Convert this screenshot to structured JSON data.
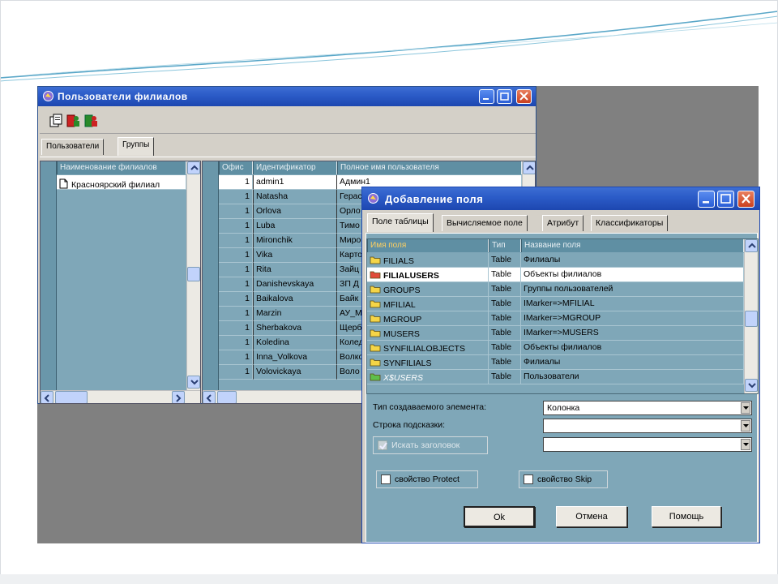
{
  "window_branches": {
    "title": "Пользователи филиалов",
    "tabs": [
      {
        "label": "Пользователи",
        "active": false
      },
      {
        "label": "Группы",
        "active": true
      }
    ],
    "branches_grid": {
      "header": "Наименование филиалов",
      "rows": [
        "Красноярский филиал"
      ]
    },
    "users_grid": {
      "headers": [
        "Офис",
        "Идентификатор",
        "Полное имя пользователя"
      ],
      "rows": [
        {
          "office": "1",
          "id": "admin1",
          "name": "Админ1"
        },
        {
          "office": "1",
          "id": "Natasha",
          "name": "Герас"
        },
        {
          "office": "1",
          "id": "Orlova",
          "name": "Орло"
        },
        {
          "office": "1",
          "id": "Luba",
          "name": "Тимо"
        },
        {
          "office": "1",
          "id": "Mironchik",
          "name": "Миро"
        },
        {
          "office": "1",
          "id": "Vika",
          "name": "Карто"
        },
        {
          "office": "1",
          "id": "Rita",
          "name": "Зайц"
        },
        {
          "office": "1",
          "id": "Danishevskaya",
          "name": "ЗП Д"
        },
        {
          "office": "1",
          "id": "Baikalova",
          "name": "Байк"
        },
        {
          "office": "1",
          "id": "Marzin",
          "name": "АУ_М"
        },
        {
          "office": "1",
          "id": "Sherbakova",
          "name": "Щерб"
        },
        {
          "office": "1",
          "id": "Koledina",
          "name": "Колед"
        },
        {
          "office": "1",
          "id": "Inna_Volkova",
          "name": "Волко"
        },
        {
          "office": "1",
          "id": "Volovickaya",
          "name": "Воло"
        }
      ]
    }
  },
  "dialog_add_field": {
    "title": "Добавление поля",
    "tabs": [
      {
        "label": "Поле таблицы",
        "active": true
      },
      {
        "label": "Вычисляемое поле",
        "active": false
      },
      {
        "label": "Атрибут",
        "active": false
      },
      {
        "label": "Классификаторы",
        "active": false
      }
    ],
    "fields_grid": {
      "headers": [
        "Имя поля",
        "Тип",
        "Название поля"
      ],
      "rows": [
        {
          "name": "FILIALS",
          "type": "Table",
          "title": "Филиалы",
          "selected": false,
          "italic": false,
          "icon": "folder-icon"
        },
        {
          "name": "FILIALUSERS",
          "type": "Table",
          "title": "Объекты филиалов",
          "selected": true,
          "italic": false,
          "icon": "folder-red-icon"
        },
        {
          "name": "GROUPS",
          "type": "Table",
          "title": "Группы пользователей",
          "selected": false,
          "italic": false,
          "icon": "folder-icon"
        },
        {
          "name": "MFILIAL",
          "type": "Table",
          "title": "IMarker=>MFILIAL",
          "selected": false,
          "italic": false,
          "icon": "folder-icon"
        },
        {
          "name": "MGROUP",
          "type": "Table",
          "title": "IMarker=>MGROUP",
          "selected": false,
          "italic": false,
          "icon": "folder-icon"
        },
        {
          "name": "MUSERS",
          "type": "Table",
          "title": "IMarker=>MUSERS",
          "selected": false,
          "italic": false,
          "icon": "folder-icon"
        },
        {
          "name": "SYNFILIALOBJECTS",
          "type": "Table",
          "title": "Объекты филиалов",
          "selected": false,
          "italic": false,
          "icon": "folder-icon"
        },
        {
          "name": "SYNFILIALS",
          "type": "Table",
          "title": "Филиалы",
          "selected": false,
          "italic": false,
          "icon": "folder-icon"
        },
        {
          "name": "X$USERS",
          "type": "Table",
          "title": "Пользователи",
          "selected": false,
          "italic": true,
          "icon": "folder-green-icon"
        }
      ]
    },
    "element_type_label": "Тип создаваемого элемента:",
    "element_type_value": "Колонка",
    "hint_label": "Строка подсказки:",
    "hint_value": "",
    "extra_value": "",
    "header_checkbox_label": "Искать заголовок",
    "protect_label": "свойство Protect",
    "skip_label": "свойство Skip",
    "ok_label": "Ok",
    "cancel_label": "Отмена",
    "help_label": "Помощь"
  },
  "colors": {
    "title_bar": "#2b5bc7",
    "grid_bg": "#7fa7b8",
    "grid_header": "#5f8fa3",
    "dialog_bg": "#7fa7b8"
  }
}
